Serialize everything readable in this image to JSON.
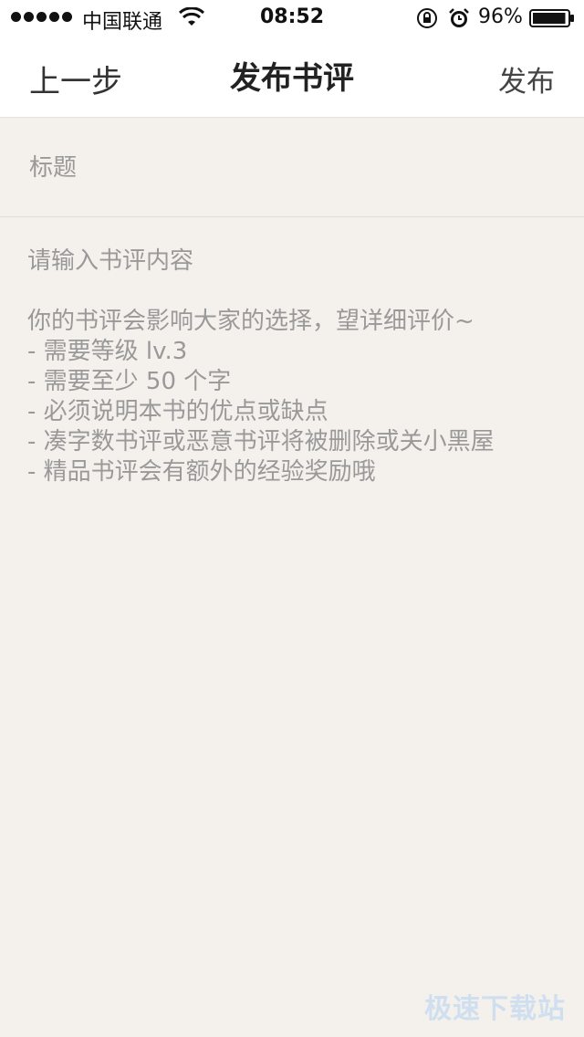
{
  "status_bar": {
    "carrier": "中国联通",
    "time": "08:52",
    "battery_percent": "96%",
    "battery_level": 0.96,
    "icons": [
      "signal-dots",
      "wifi-icon",
      "rotation-lock-icon",
      "alarm-icon",
      "battery-icon"
    ]
  },
  "nav": {
    "back_label": "上一步",
    "title": "发布书评",
    "publish_label": "发布"
  },
  "form": {
    "title_placeholder": "标题",
    "content_placeholder_lines": [
      "请输入书评内容",
      "",
      "你的书评会影响大家的选择，望详细评价~",
      "- 需要等级 lv.3",
      "- 需要至少 50 个字",
      "- 必须说明本书的优点或缺点",
      "- 凑字数书评或恶意书评将被删除或关小黑屋",
      "- 精品书评会有额外的经验奖励哦"
    ]
  },
  "watermark": "极速下载站",
  "colors": {
    "background": "#f4f1ec",
    "bar_background": "#ffffff",
    "placeholder_text": "#999999",
    "watermark": "#cfdff0"
  }
}
